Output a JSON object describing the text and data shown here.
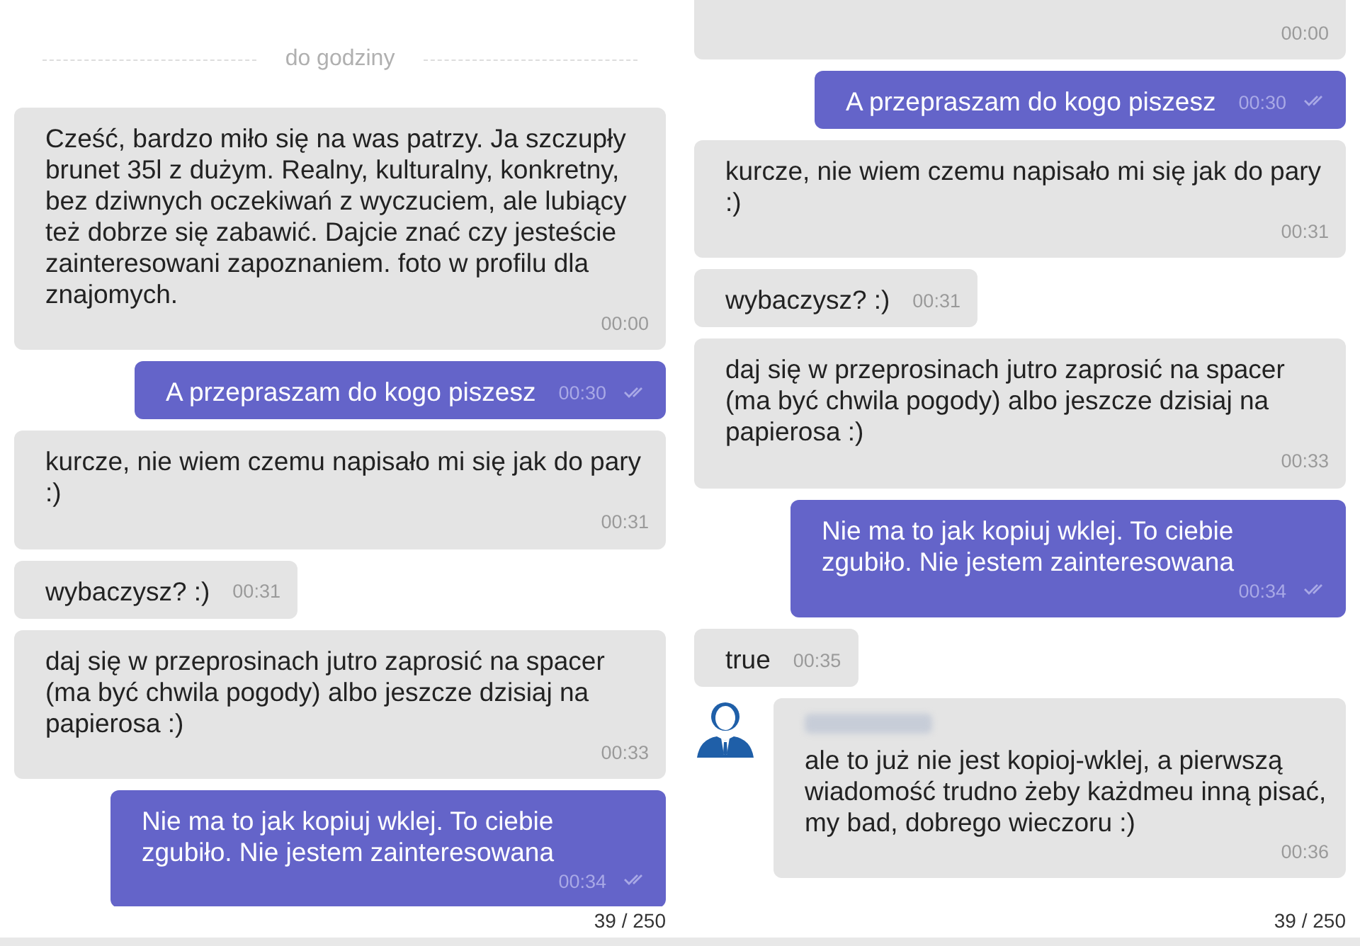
{
  "panels": [
    {
      "divider": "do godziny",
      "messages": [
        {
          "kind": "incoming",
          "text": "Cześć, bardzo miło się na was patrzy. Ja szczupły brunet 35l z dużym. Realny, kulturalny, konkretny, bez dziwnych oczekiwań z wyczuciem, ale lubiący też dobrze się zabawić. Dajcie znać czy jesteście zainteresowani zapoznaniem. foto w profilu dla znajomych.",
          "time": "00:00"
        },
        {
          "kind": "outgoing",
          "text": "A przepraszam do kogo piszesz",
          "time": "00:30",
          "read": true
        },
        {
          "kind": "incoming",
          "text": "kurcze, nie wiem czemu napisało mi się jak do pary :)",
          "time": "00:31"
        },
        {
          "kind": "incoming",
          "text": "wybaczysz? :)",
          "time": "00:31"
        },
        {
          "kind": "incoming",
          "text": "daj się w przeprosinach jutro zaprosić na spacer (ma być chwila pogody) albo jeszcze dzisiaj na papierosa :)",
          "time": "00:33"
        },
        {
          "kind": "outgoing",
          "text": "Nie ma to jak kopiuj wklej. To ciebie zgubiło. Nie jestem zainteresowana",
          "time": "00:34",
          "read": true
        }
      ],
      "counter": "39 / 250"
    },
    {
      "messages": [
        {
          "kind": "incoming",
          "time": "00:00"
        },
        {
          "kind": "outgoing",
          "text": "A przepraszam do kogo piszesz",
          "time": "00:30",
          "read": true
        },
        {
          "kind": "incoming",
          "text": "kurcze, nie wiem czemu napisało mi się jak do pary :)",
          "time": "00:31"
        },
        {
          "kind": "incoming",
          "text": "wybaczysz? :)",
          "time": "00:31"
        },
        {
          "kind": "incoming",
          "text": "daj się w przeprosinach jutro zaprosić na spacer (ma być chwila pogody) albo jeszcze dzisiaj na papierosa :)",
          "time": "00:33"
        },
        {
          "kind": "outgoing",
          "text": "Nie ma to jak kopiuj wklej. To ciebie zgubiło. Nie jestem zainteresowana",
          "time": "00:34",
          "read": true
        },
        {
          "kind": "incoming",
          "text": "true",
          "time": "00:35"
        },
        {
          "kind": "incoming",
          "avatar": true,
          "sender_hidden": true,
          "text": "ale to już nie jest kopioj-wklej, a pierwszą wiadomość trudno żeby każdmeu inną pisać, my bad, dobrego wieczoru :)",
          "time": "00:36"
        }
      ],
      "counter": "39 / 250"
    }
  ]
}
